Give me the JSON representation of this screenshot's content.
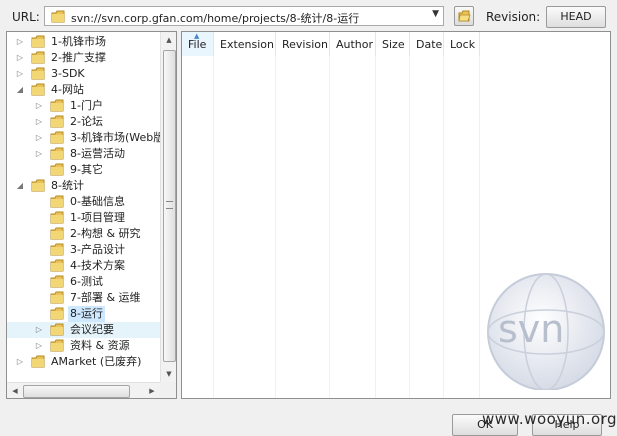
{
  "toolbar": {
    "url_label": "URL:",
    "url_value": "svn://svn.corp.gfan.com/home/projects/8-统计/8-运行",
    "revision_label": "Revision:",
    "head_button": "HEAD"
  },
  "tree": {
    "items": [
      {
        "label": "1-机锋市场",
        "depth": 0,
        "expander": true
      },
      {
        "label": "2-推广支撑",
        "depth": 0,
        "expander": true
      },
      {
        "label": "3-SDK",
        "depth": 0,
        "expander": true
      },
      {
        "label": "4-网站",
        "depth": 0,
        "expander": "open"
      },
      {
        "label": "1-门户",
        "depth": 1,
        "expander": true
      },
      {
        "label": "2-论坛",
        "depth": 1,
        "expander": true
      },
      {
        "label": "3-机锋市场(Web版",
        "depth": 1,
        "expander": true
      },
      {
        "label": "8-运营活动",
        "depth": 1,
        "expander": true
      },
      {
        "label": "9-其它",
        "depth": 1,
        "expander": false
      },
      {
        "label": "8-统计",
        "depth": 0,
        "expander": "open"
      },
      {
        "label": "0-基础信息",
        "depth": 1,
        "expander": false
      },
      {
        "label": "1-项目管理",
        "depth": 1,
        "expander": false
      },
      {
        "label": "2-构想 & 研究",
        "depth": 1,
        "expander": false
      },
      {
        "label": "3-产品设计",
        "depth": 1,
        "expander": false
      },
      {
        "label": "4-技术方案",
        "depth": 1,
        "expander": false
      },
      {
        "label": "6-测试",
        "depth": 1,
        "expander": false
      },
      {
        "label": "7-部署 & 运维",
        "depth": 1,
        "expander": false
      },
      {
        "label": "8-运行",
        "depth": 1,
        "expander": false,
        "selected": true
      },
      {
        "label": "会议纪要",
        "depth": 1,
        "expander": true,
        "hover": true
      },
      {
        "label": "资料 & 资源",
        "depth": 1,
        "expander": true
      },
      {
        "label": "AMarket (已废弃)",
        "depth": 0,
        "expander": true
      }
    ]
  },
  "file_list": {
    "columns": [
      "File",
      "Extension",
      "Revision",
      "Author",
      "Size",
      "Date",
      "Lock"
    ]
  },
  "footer": {
    "ok_button": "OK",
    "help_button": "Help",
    "watermark": "www.wooyun.org"
  },
  "logo": {
    "text": "svn"
  },
  "colors": {
    "folder": "#e8c35a",
    "selection": "#cde8ff",
    "hover": "#e5f3fb"
  }
}
